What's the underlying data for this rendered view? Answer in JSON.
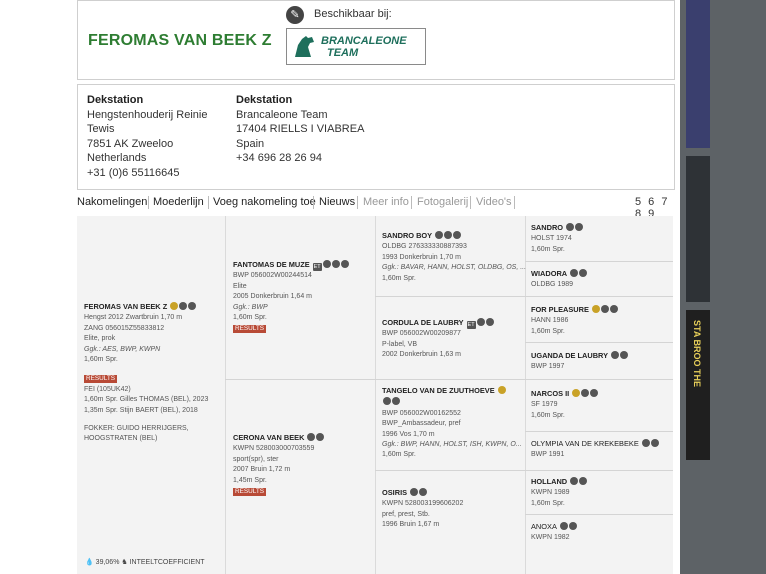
{
  "header": {
    "horse_name": "FEROMAS VAN BEEK Z",
    "available_label": "Beschikbaar bij:",
    "logo_line1": "BRANCALEONE",
    "logo_line2": "TEAM"
  },
  "stations": [
    {
      "heading": "Dekstation",
      "line1": "Hengstenhouderij Reinie",
      "line2": "Tewis",
      "line3": "7851 AK Zweeloo",
      "line4": "Netherlands",
      "line5": "+31 (0)6 55116645"
    },
    {
      "heading": "Dekstation",
      "line1": "Brancaleone Team",
      "line2": "17404 RIELLS I VIABREA",
      "line3": "Spain",
      "line4": "+34 696 28 26 94",
      "line5": ""
    }
  ],
  "tabs": {
    "nakomelingen": "Nakomelingen",
    "moederlijn": "Moederlijn",
    "voeg": "Voeg nakomeling toe",
    "nieuws": "Nieuws",
    "meer": "Meer info",
    "foto": "Fotogalerij",
    "videos": "Video's",
    "pages": "5 6 7 8 9"
  },
  "pedigree": {
    "main": {
      "name": "FEROMAS VAN BEEK Z",
      "l1": "Hengst 2012 Zwartbruin 1,70 m",
      "l2": "ZANG 056015Z55833812",
      "l3": "Elite, prok",
      "l4": "Ggk.: AES, BWP, KWPN",
      "l5": "1,60m Spr.",
      "results": "RESULTS",
      "l6": "FEI (105UK42)",
      "l7": "1,60m Spr. Gilles THOMAS (BEL), 2023",
      "l8": "1,35m Spr. Stijn BAERT (BEL), 2018",
      "l9": "FOKKER: GUIDO HERRIJGERS,",
      "l10": "HOOGSTRATEN (BEL)"
    },
    "sire": {
      "name": "FANTOMAS DE MUZE",
      "l1": "BWP 056002W00244514",
      "l2": "Elite",
      "l3": "2005 Donkerbruin 1,64 m",
      "l4": "Ggk.: BWP",
      "l5": "1,60m Spr.",
      "results": "RESULTS"
    },
    "dam": {
      "name": "CERONA VAN BEEK",
      "l1": "KWPN 528003000703559",
      "l2": "sport(spr), ster",
      "l3": "2007 Bruin 1,72 m",
      "l4": "1,45m Spr.",
      "results": "RESULTS"
    },
    "ss": {
      "name": "SANDRO BOY",
      "l1": "OLDBG 276333330887393",
      "l2": "1993 Donkerbruin 1,70 m",
      "l3": "Ggk.: BAVAR, HANN, HOLST, OLDBG, OS, ...",
      "l4": "1,60m Spr."
    },
    "sd": {
      "name": "CORDULA DE LAUBRY",
      "l1": "BWP 056002W00209877",
      "l2": "P-label, VB",
      "l3": "2002 Donkerbruin 1,63 m"
    },
    "ds": {
      "name": "TANGELO VAN DE ZUUTHOEVE",
      "l1": "BWP 056002W00162552",
      "l2": "BWP_Ambassadeur, pref",
      "l3": "1996 Vos 1,70 m",
      "l4": "Ggk.: BWP, HANN, HOLST, ISH, KWPN, O...",
      "l5": "1,60m Spr."
    },
    "dd": {
      "name": "OSIRIS",
      "l1": "KWPN 528003199606202",
      "l2": "pref, prest, Stb.",
      "l3": "1996 Bruin 1,67 m"
    },
    "g": [
      {
        "name": "SANDRO",
        "l1": "HOLST 1974",
        "l2": "1,60m Spr."
      },
      {
        "name": "WIADORA",
        "l1": "OLDBG 1989",
        "l2": ""
      },
      {
        "name": "FOR PLEASURE",
        "l1": "HANN 1986",
        "l2": "1,60m Spr."
      },
      {
        "name": "UGANDA DE LAUBRY",
        "l1": "BWP 1997",
        "l2": ""
      },
      {
        "name": "NARCOS II",
        "l1": "SF 1979",
        "l2": "1,60m Spr."
      },
      {
        "name": "OLYMPIA VAN DE KREKEBEKE",
        "l1": "BWP 1991",
        "l2": ""
      },
      {
        "name": "HOLLAND",
        "l1": "KWPN 1989",
        "l2": "1,60m Spr."
      },
      {
        "name": "ANOXA",
        "l1": "KWPN 1982",
        "l2": ""
      }
    ]
  },
  "footer": {
    "percent": "39,06%",
    "label": "INTEELTCOEFFICIENT"
  },
  "side_ad": {
    "text": "STA BROO THE"
  }
}
